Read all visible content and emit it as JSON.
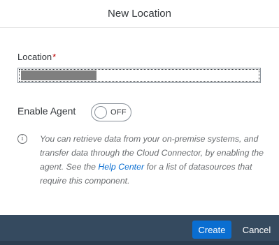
{
  "dialog": {
    "title": "New Location"
  },
  "location_field": {
    "label": "Location",
    "required_marker": "*",
    "value": "████████████"
  },
  "enable_agent": {
    "label": "Enable Agent",
    "state_text": "OFF",
    "enabled": false
  },
  "info": {
    "icon": "info-icon",
    "text_before": "You can retrieve data from your on-premise systems, and transfer data through the Cloud Connector, by enabling the agent. See the ",
    "link_text": "Help Center",
    "text_after": " for a list of datasources that require this component."
  },
  "footer": {
    "create_label": "Create",
    "cancel_label": "Cancel"
  },
  "colors": {
    "accent": "#0a6ed1",
    "footer_bg": "#354a5f",
    "required": "#bb0000"
  }
}
